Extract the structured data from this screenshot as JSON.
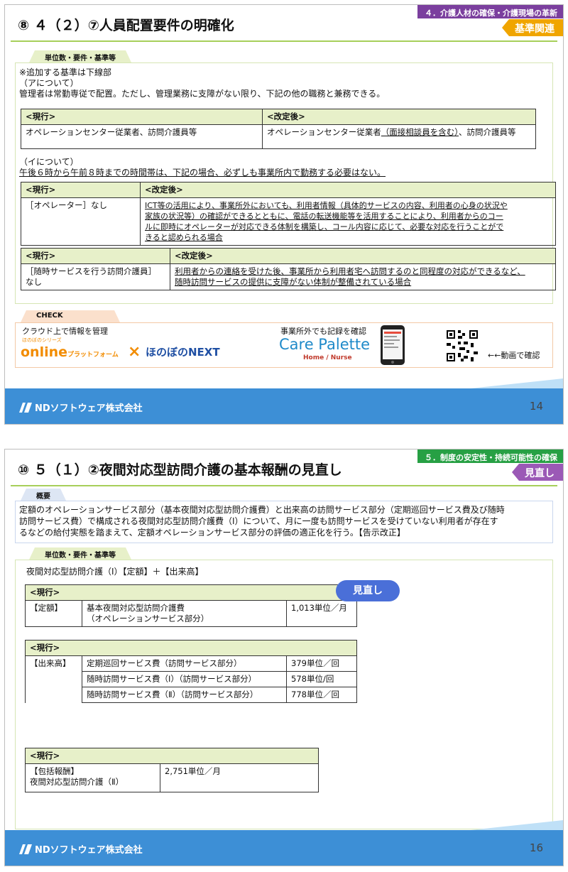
{
  "slide1": {
    "category": "４．介護人材の確保・介護現場の革新",
    "badge": "基準関連",
    "title": "⑧ ４（２）⑦人員配置要件の明確化",
    "section_label": "単位数・要件・基準等",
    "note": "※追加する基準は下線部",
    "a_heading": "（アについて）",
    "a_text": "管理者は常勤専従で配置。ただし、管理業務に支障がない限り、下記の他の職務と兼務できる。",
    "table_a": {
      "col_current": "<現行>",
      "col_revised": "<改定後>",
      "current": "オペレーションセンター従業者、訪問介護員等",
      "revised_pre": "オペレーションセンター従業者",
      "revised_added": "（面接相談員を含む）",
      "revised_post": "、訪問介護員等"
    },
    "i_heading": "（イについて）",
    "i_text": "午後６時から午前８時までの時間帯は、下記の場合、必ずしも事業所内で勤務する必要はない。",
    "table_b": {
      "col_current": "<現行>",
      "col_revised": "<改定後>",
      "current": "［オペレーター］なし",
      "revised_lines": [
        "ICT等の活用により、事業所外においても、利用者情報（具体的サービスの内容、利用者の心身の状況や",
        "家族の状況等）の確認ができるとともに、電話の転送機能等を活用することにより、利用者からのコー",
        "ルに即時にオペレーターが対応できる体制を構築し、コール内容に応じて、必要な対応を行うことがで",
        "きると認められる場合"
      ]
    },
    "table_c": {
      "col_current": "<現行>",
      "col_revised": "<改定後>",
      "current_lines": [
        "［随時サービスを行う訪問介護員］",
        "なし"
      ],
      "revised_lines": [
        "利用者からの連絡を受けた後、事業所から利用者宅へ訪問するのと同程度の対応ができるなど、",
        "随時訪問サービスの提供に支障がない体制が整備されている場合"
      ]
    },
    "check": {
      "label": "CHECK",
      "cloud_text": "クラウド上で情報を管理",
      "series_text": "ほのぼのシリーズ",
      "online": "online",
      "platform": "プラットフォーム",
      "times": "×",
      "next": "ほのぼのNEXT",
      "record_text": "事業所外でも記録を確認",
      "care_palette": "Care Palette",
      "home_nurse": "Home / Nurse",
      "video": "←←動画で確認"
    },
    "company": "NDソフトウェア株式会社",
    "page": "14"
  },
  "slide2": {
    "category": "５．制度の安定性・持続可能性の確保",
    "badge": "見直し",
    "title": "⑩ ５（１）②夜間対応型訪問介護の基本報酬の見直し",
    "overview_label": "概要",
    "overview_lines": [
      "定額のオペレーションサービス部分（基本夜間対応型訪問介護費）と出来高の訪問サービス部分（定期巡回サービス費及び随時",
      "訪問サービス費）で構成される夜間対応型訪問介護費（Ⅰ）について、月に一度も訪問サービスを受けていない利用者が存在す",
      "るなどの給付実態を踏まえて、定額オペレーションサービス部分の評価の適正化を行う。【告示改正】"
    ],
    "section_label": "単位数・要件・基準等",
    "formula": "夜間対応型訪問介護（Ⅰ）【定額】＋【出来高】",
    "bubble": "見直し",
    "table1": {
      "header": "<現行>",
      "label": "【定額】",
      "item_lines": [
        "基本夜間対応型訪問介護費",
        "（オペレーションサービス部分）"
      ],
      "value": "1,013単位／月"
    },
    "table2": {
      "header": "<現行>",
      "label": "【出来高】",
      "rows": [
        {
          "item": "定期巡回サービス費（訪問サービス部分）",
          "value": "379単位／回"
        },
        {
          "item": "随時訪問サービス費（Ⅰ）（訪問サービス部分）",
          "value": "578単位/回"
        },
        {
          "item": "随時訪問サービス費（Ⅱ）（訪問サービス部分）",
          "value": "778単位／回"
        }
      ]
    },
    "table3": {
      "header": "<現行>",
      "label_lines": [
        "【包括報酬】",
        "夜間対応型訪問介護（Ⅱ）"
      ],
      "value": "2,751単位／月"
    },
    "company": "NDソフトウェア株式会社",
    "page": "16"
  },
  "colors": {
    "category1": "#7b3f9e",
    "badge1": "#f0a500",
    "category2": "#27a044",
    "badge2": "#9b59b6",
    "footer": "#3d8fd6",
    "accent_green": "#a7cf5a",
    "online_orange": "#f28c00",
    "next_blue": "#1f4fa3",
    "bubble_blue": "#4a6fd8"
  }
}
